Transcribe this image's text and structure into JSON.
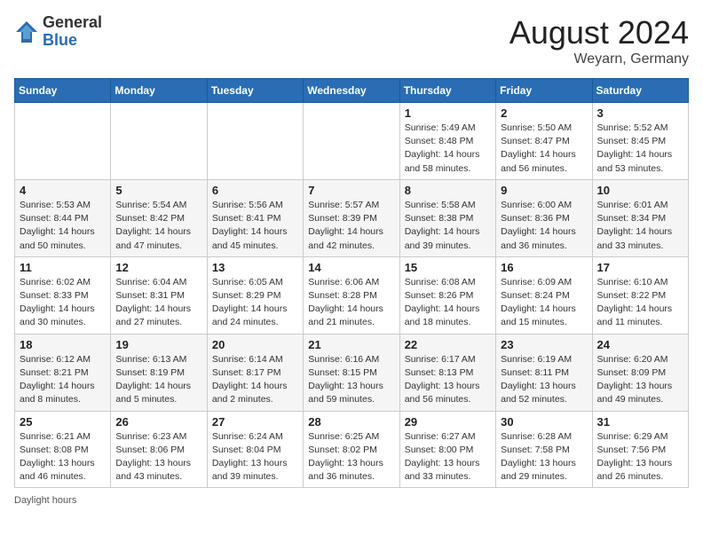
{
  "header": {
    "logo_general": "General",
    "logo_blue": "Blue",
    "title": "August 2024",
    "location": "Weyarn, Germany"
  },
  "days_of_week": [
    "Sunday",
    "Monday",
    "Tuesday",
    "Wednesday",
    "Thursday",
    "Friday",
    "Saturday"
  ],
  "weeks": [
    [
      {
        "day": "",
        "info": ""
      },
      {
        "day": "",
        "info": ""
      },
      {
        "day": "",
        "info": ""
      },
      {
        "day": "",
        "info": ""
      },
      {
        "day": "1",
        "info": "Sunrise: 5:49 AM\nSunset: 8:48 PM\nDaylight: 14 hours\nand 58 minutes."
      },
      {
        "day": "2",
        "info": "Sunrise: 5:50 AM\nSunset: 8:47 PM\nDaylight: 14 hours\nand 56 minutes."
      },
      {
        "day": "3",
        "info": "Sunrise: 5:52 AM\nSunset: 8:45 PM\nDaylight: 14 hours\nand 53 minutes."
      }
    ],
    [
      {
        "day": "4",
        "info": "Sunrise: 5:53 AM\nSunset: 8:44 PM\nDaylight: 14 hours\nand 50 minutes."
      },
      {
        "day": "5",
        "info": "Sunrise: 5:54 AM\nSunset: 8:42 PM\nDaylight: 14 hours\nand 47 minutes."
      },
      {
        "day": "6",
        "info": "Sunrise: 5:56 AM\nSunset: 8:41 PM\nDaylight: 14 hours\nand 45 minutes."
      },
      {
        "day": "7",
        "info": "Sunrise: 5:57 AM\nSunset: 8:39 PM\nDaylight: 14 hours\nand 42 minutes."
      },
      {
        "day": "8",
        "info": "Sunrise: 5:58 AM\nSunset: 8:38 PM\nDaylight: 14 hours\nand 39 minutes."
      },
      {
        "day": "9",
        "info": "Sunrise: 6:00 AM\nSunset: 8:36 PM\nDaylight: 14 hours\nand 36 minutes."
      },
      {
        "day": "10",
        "info": "Sunrise: 6:01 AM\nSunset: 8:34 PM\nDaylight: 14 hours\nand 33 minutes."
      }
    ],
    [
      {
        "day": "11",
        "info": "Sunrise: 6:02 AM\nSunset: 8:33 PM\nDaylight: 14 hours\nand 30 minutes."
      },
      {
        "day": "12",
        "info": "Sunrise: 6:04 AM\nSunset: 8:31 PM\nDaylight: 14 hours\nand 27 minutes."
      },
      {
        "day": "13",
        "info": "Sunrise: 6:05 AM\nSunset: 8:29 PM\nDaylight: 14 hours\nand 24 minutes."
      },
      {
        "day": "14",
        "info": "Sunrise: 6:06 AM\nSunset: 8:28 PM\nDaylight: 14 hours\nand 21 minutes."
      },
      {
        "day": "15",
        "info": "Sunrise: 6:08 AM\nSunset: 8:26 PM\nDaylight: 14 hours\nand 18 minutes."
      },
      {
        "day": "16",
        "info": "Sunrise: 6:09 AM\nSunset: 8:24 PM\nDaylight: 14 hours\nand 15 minutes."
      },
      {
        "day": "17",
        "info": "Sunrise: 6:10 AM\nSunset: 8:22 PM\nDaylight: 14 hours\nand 11 minutes."
      }
    ],
    [
      {
        "day": "18",
        "info": "Sunrise: 6:12 AM\nSunset: 8:21 PM\nDaylight: 14 hours\nand 8 minutes."
      },
      {
        "day": "19",
        "info": "Sunrise: 6:13 AM\nSunset: 8:19 PM\nDaylight: 14 hours\nand 5 minutes."
      },
      {
        "day": "20",
        "info": "Sunrise: 6:14 AM\nSunset: 8:17 PM\nDaylight: 14 hours\nand 2 minutes."
      },
      {
        "day": "21",
        "info": "Sunrise: 6:16 AM\nSunset: 8:15 PM\nDaylight: 13 hours\nand 59 minutes."
      },
      {
        "day": "22",
        "info": "Sunrise: 6:17 AM\nSunset: 8:13 PM\nDaylight: 13 hours\nand 56 minutes."
      },
      {
        "day": "23",
        "info": "Sunrise: 6:19 AM\nSunset: 8:11 PM\nDaylight: 13 hours\nand 52 minutes."
      },
      {
        "day": "24",
        "info": "Sunrise: 6:20 AM\nSunset: 8:09 PM\nDaylight: 13 hours\nand 49 minutes."
      }
    ],
    [
      {
        "day": "25",
        "info": "Sunrise: 6:21 AM\nSunset: 8:08 PM\nDaylight: 13 hours\nand 46 minutes."
      },
      {
        "day": "26",
        "info": "Sunrise: 6:23 AM\nSunset: 8:06 PM\nDaylight: 13 hours\nand 43 minutes."
      },
      {
        "day": "27",
        "info": "Sunrise: 6:24 AM\nSunset: 8:04 PM\nDaylight: 13 hours\nand 39 minutes."
      },
      {
        "day": "28",
        "info": "Sunrise: 6:25 AM\nSunset: 8:02 PM\nDaylight: 13 hours\nand 36 minutes."
      },
      {
        "day": "29",
        "info": "Sunrise: 6:27 AM\nSunset: 8:00 PM\nDaylight: 13 hours\nand 33 minutes."
      },
      {
        "day": "30",
        "info": "Sunrise: 6:28 AM\nSunset: 7:58 PM\nDaylight: 13 hours\nand 29 minutes."
      },
      {
        "day": "31",
        "info": "Sunrise: 6:29 AM\nSunset: 7:56 PM\nDaylight: 13 hours\nand 26 minutes."
      }
    ]
  ],
  "footer": "Daylight hours"
}
